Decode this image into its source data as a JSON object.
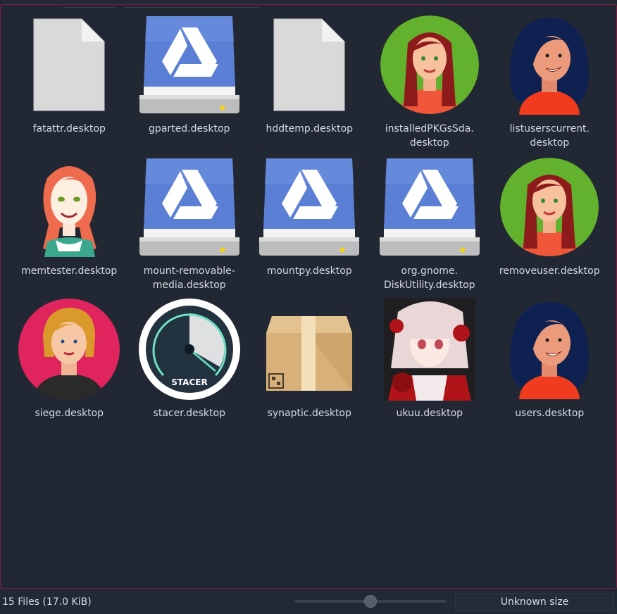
{
  "files": [
    {
      "label": "fatattr.desktop",
      "icon": "document-icon"
    },
    {
      "label": "gparted.desktop",
      "icon": "drive-icon"
    },
    {
      "label": "hddtemp.desktop",
      "icon": "document-icon"
    },
    {
      "label": "installedPKGsSda.\ndesktop",
      "icon": "avatar-green-redhair-icon"
    },
    {
      "label": "listuserscurrent.\ndesktop",
      "icon": "avatar-blue-woman-icon"
    },
    {
      "label": "memtester.desktop",
      "icon": "avatar-sketch-woman-icon"
    },
    {
      "label": "mount-removable-\nmedia.desktop",
      "icon": "drive-icon"
    },
    {
      "label": "mountpy.desktop",
      "icon": "drive-icon"
    },
    {
      "label": "org.gnome.\nDiskUtility.desktop",
      "icon": "drive-icon"
    },
    {
      "label": "removeuser.desktop",
      "icon": "avatar-green-redhair-icon"
    },
    {
      "label": "siege.desktop",
      "icon": "avatar-pink-blonde-icon"
    },
    {
      "label": "stacer.desktop",
      "icon": "stacer-gauge-icon"
    },
    {
      "label": "synaptic.desktop",
      "icon": "package-box-icon"
    },
    {
      "label": "ukuu.desktop",
      "icon": "anime-girl-icon"
    },
    {
      "label": "users.desktop",
      "icon": "avatar-blue-woman-icon"
    }
  ],
  "stacer_text": "STACER",
  "status": {
    "summary": "15 Files (17.0 KiB)",
    "size_label": "Unknown size",
    "zoom_level": 0.5
  },
  "colors": {
    "background": "#222833",
    "border_accent": "#7a1e3f",
    "drive_blue": "#5b7fd4",
    "avatar_green": "#62b22e",
    "avatar_pink": "#e0245e"
  }
}
